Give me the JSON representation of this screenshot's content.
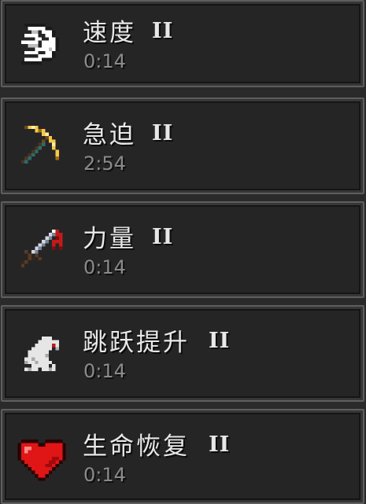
{
  "effects": [
    {
      "name": "速度",
      "level": "II",
      "time": "0:14",
      "icon": "speed-icon",
      "accent": "#ffffff"
    },
    {
      "name": "急迫",
      "level": "II",
      "time": "2:54",
      "icon": "golden-pickaxe-icon",
      "accent": "#f4c542"
    },
    {
      "name": "力量",
      "level": "II",
      "time": "0:14",
      "icon": "bloody-sword-icon",
      "accent": "#b01818"
    },
    {
      "name": "跳跃提升",
      "level": "II",
      "time": "0:14",
      "icon": "rabbit-icon",
      "accent": "#dddddd"
    },
    {
      "name": "生命恢复",
      "level": "II",
      "time": "0:14",
      "icon": "heart-icon",
      "accent": "#e01515"
    }
  ]
}
